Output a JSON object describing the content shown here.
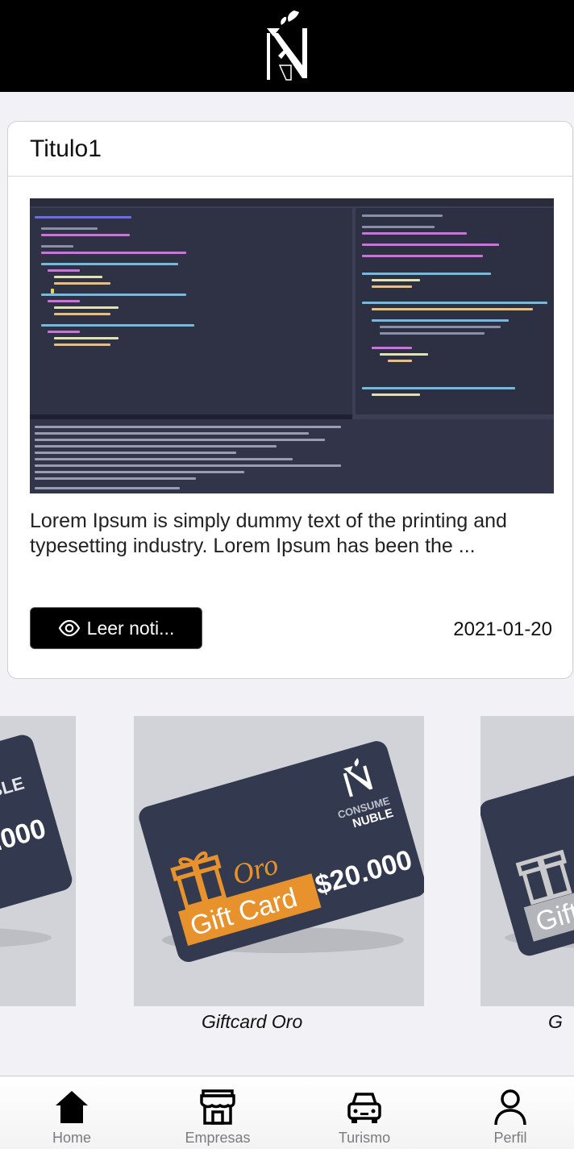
{
  "header": {
    "logo_icon": "consume-nuble-logo-icon"
  },
  "news": {
    "title": "Titulo1",
    "image_icon": "code-screenshot-image",
    "description": "Lorem Ipsum is simply dummy text of the printing and typesetting industry. Lorem Ipsum has been the ...",
    "read_button_label": "Leer noti...",
    "read_button_icon": "eye-icon",
    "date": "2021-01-20"
  },
  "giftcards": {
    "items": [
      {
        "label": "Giftcard Oro",
        "tier": "Oro",
        "card_text": "Gift Card",
        "amount": "$20.000",
        "brand_top": "CONSUME",
        "brand_bottom": "NUBLE"
      },
      {
        "label": "G"
      }
    ],
    "accent_color": "#e8922e",
    "card_color": "#333a4f"
  },
  "bottom_nav": {
    "items": [
      {
        "label": "Home",
        "icon": "home-icon",
        "active": true
      },
      {
        "label": "Empresas",
        "icon": "store-icon"
      },
      {
        "label": "Turismo",
        "icon": "car-icon"
      },
      {
        "label": "Perfil",
        "icon": "person-icon"
      }
    ]
  }
}
